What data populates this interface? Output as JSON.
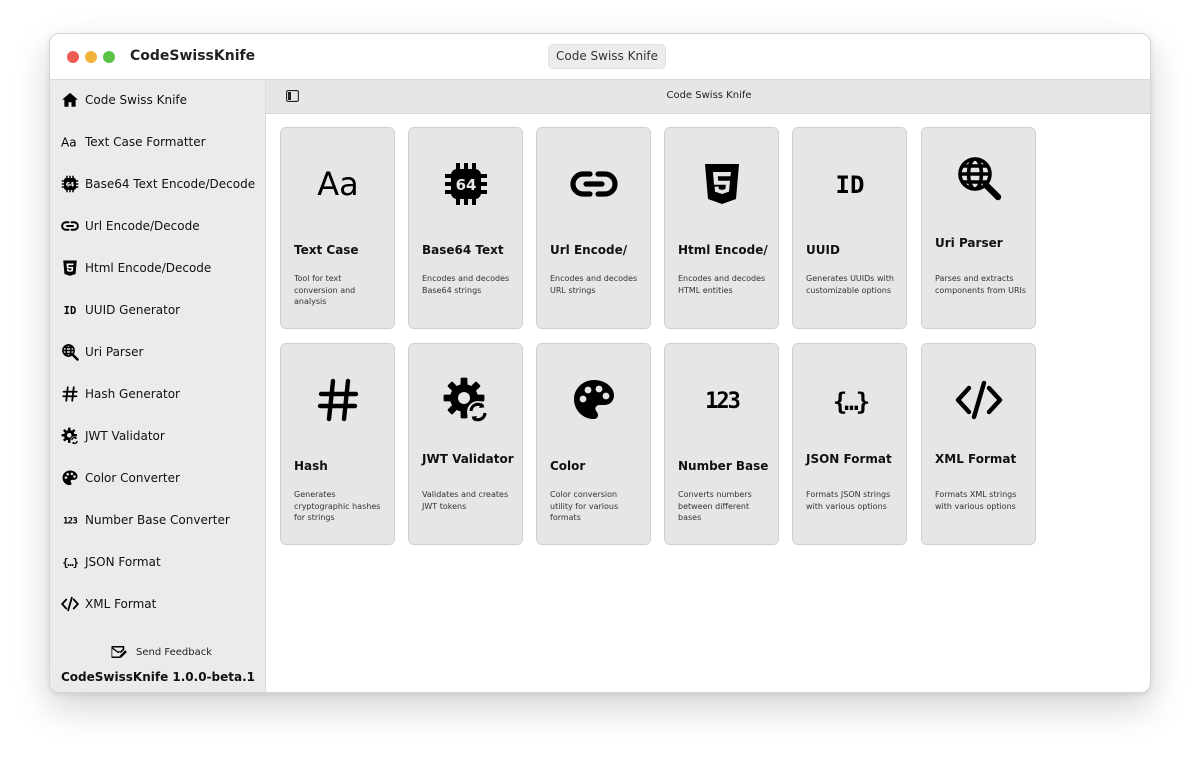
{
  "window": {
    "app_title": "CodeSwissKnife",
    "title_pill": "Code Swiss Knife"
  },
  "sidebar": {
    "items": [
      {
        "label": "Code Swiss Knife",
        "icon": "home-icon"
      },
      {
        "label": "Text Case Formatter",
        "icon": "text-case-icon"
      },
      {
        "label": "Base64 Text Encode/Decode",
        "icon": "base64-chip-icon"
      },
      {
        "label": "Url Encode/Decode",
        "icon": "link-icon"
      },
      {
        "label": "Html Encode/Decode",
        "icon": "html5-icon"
      },
      {
        "label": "UUID Generator",
        "icon": "id-icon"
      },
      {
        "label": "Uri Parser",
        "icon": "globe-search-icon"
      },
      {
        "label": "Hash Generator",
        "icon": "hash-icon"
      },
      {
        "label": "JWT Validator",
        "icon": "gear-sync-icon"
      },
      {
        "label": "Color Converter",
        "icon": "palette-icon"
      },
      {
        "label": "Number Base Converter",
        "icon": "numbers-icon"
      },
      {
        "label": "JSON Format",
        "icon": "json-braces-icon"
      },
      {
        "label": "XML Format",
        "icon": "code-tag-icon"
      }
    ],
    "feedback_label": "Send Feedback",
    "version": "CodeSwissKnife 1.0.0-beta.1"
  },
  "main": {
    "title": "Code Swiss Knife",
    "cards": [
      {
        "title": "Text Case",
        "desc": "Tool for text conversion and analysis",
        "icon": "text-case-icon"
      },
      {
        "title": "Base64 Text",
        "desc": "Encodes and decodes Base64 strings",
        "icon": "base64-chip-icon"
      },
      {
        "title": "Url Encode/",
        "desc": "Encodes and decodes URL strings",
        "icon": "link-icon"
      },
      {
        "title": "Html Encode/",
        "desc": "Encodes and decodes HTML entities",
        "icon": "html5-icon"
      },
      {
        "title": "UUID",
        "desc": "Generates UUIDs with customizable options",
        "icon": "id-icon"
      },
      {
        "title": "Uri Parser",
        "desc": "Parses and extracts components from URIs",
        "icon": "globe-search-icon"
      },
      {
        "title": "Hash",
        "desc": "Generates cryptographic hashes for strings",
        "icon": "hash-icon"
      },
      {
        "title": "JWT Validator",
        "desc": "Validates and creates JWT tokens",
        "icon": "gear-sync-icon"
      },
      {
        "title": "Color",
        "desc": "Color conversion utility for various formats",
        "icon": "palette-icon"
      },
      {
        "title": "Number Base",
        "desc": "Converts numbers between different bases",
        "icon": "numbers-icon"
      },
      {
        "title": "JSON Format",
        "desc": "Formats JSON strings with various options",
        "icon": "json-braces-icon"
      },
      {
        "title": "XML Format",
        "desc": "Formats XML strings with various options",
        "icon": "code-tag-icon"
      }
    ]
  },
  "colors": {
    "sidebar_bg": "#ebebeb",
    "card_bg": "#e6e6e6",
    "close": "#ee5b52",
    "minimize": "#f2b33c",
    "zoom": "#5ac245"
  }
}
